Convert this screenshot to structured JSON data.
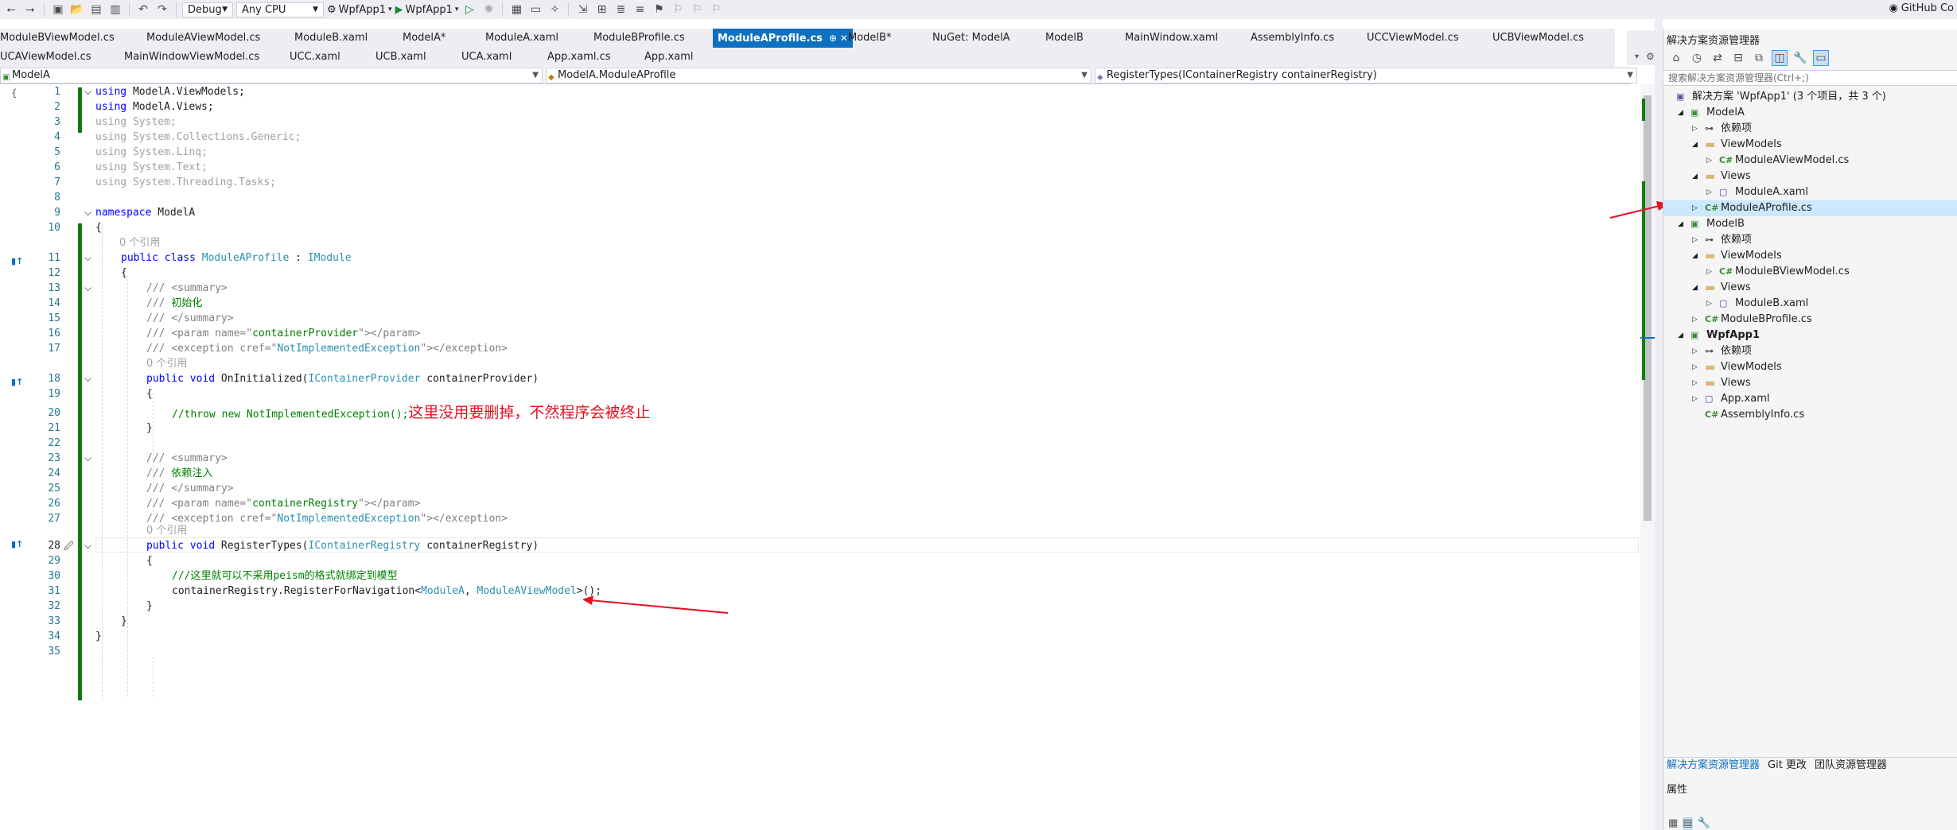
{
  "toolbar": {
    "config": "Debug",
    "platform": "Any CPU",
    "startup_project": "WpfApp1",
    "run_label": "WpfApp1",
    "github": "GitHub Co"
  },
  "tabs_row1": [
    "ModuleBViewModel.cs",
    "ModuleAViewModel.cs",
    "ModuleB.xaml",
    "ModelA*",
    "ModuleA.xaml",
    "ModuleBProfile.cs",
    "ModuleAProfile.cs",
    "ModelB*",
    "NuGet: ModelA",
    "ModelB",
    "MainWindow.xaml",
    "AssemblyInfo.cs",
    "UCCViewModel.cs",
    "UCBViewModel.cs"
  ],
  "tabs_row2": [
    "UCAViewModel.cs",
    "MainWindowViewModel.cs",
    "UCC.xaml",
    "UCB.xaml",
    "UCA.xaml",
    "App.xaml.cs",
    "App.xaml"
  ],
  "tab_active_pin": "⊕ ✕",
  "navbar": {
    "project": "ModelA",
    "class": "ModelA.ModuleAProfile",
    "member": "RegisterTypes(IContainerRegistry containerRegistry)"
  },
  "code": {
    "l1_a": "using",
    "l1_b": " ModelA.ViewModels;",
    "l2_a": "using",
    "l2_b": " ModelA.Views;",
    "l3": "using System;",
    "l4": "using System.Collections.Generic;",
    "l5": "using System.Linq;",
    "l6": "using System.Text;",
    "l7": "using System.Threading.Tasks;",
    "l9_a": "namespace",
    "l9_b": " ModelA",
    "l10": "{",
    "lens1": "0 个引用",
    "l11_a": "public class ",
    "l11_b": "ModuleAProfile",
    "l11_c": " : ",
    "l11_d": "IModule",
    "l12": "{",
    "l13_a": "/// ",
    "l13_b": "<summary>",
    "l14_a": "/// ",
    "l14_b": "初始化",
    "l15_a": "/// ",
    "l15_b": "</summary>",
    "l16_a": "/// ",
    "l16_b": "<param name=\"",
    "l16_c": "containerProvider",
    "l16_d": "\"></param>",
    "l17_a": "/// ",
    "l17_b": "<exception cref=\"",
    "l17_c": "NotImplementedException",
    "l17_d": "\"></exception>",
    "lens2": "0 个引用",
    "l18_a": "public void ",
    "l18_b": "OnInitialized(",
    "l18_c": "IContainerProvider",
    "l18_d": " containerProvider)",
    "l19": "{",
    "l20_a": "//throw new NotImplementedException();",
    "l20_note": "这里没用要删掉，不然程序会被终止",
    "l21": "}",
    "l23_a": "/// ",
    "l23_b": "<summary>",
    "l24_a": "/// ",
    "l24_b": "依赖注入",
    "l25_a": "/// ",
    "l25_b": "</summary>",
    "l26_a": "/// ",
    "l26_b": "<param name=\"",
    "l26_c": "containerRegistry",
    "l26_d": "\"></param>",
    "l27_a": "/// ",
    "l27_b": "<exception cref=\"",
    "l27_c": "NotImplementedException",
    "l27_d": "\"></exception>",
    "lens3": "0 个引用",
    "l28_a": "public void ",
    "l28_b": "RegisterTypes(",
    "l28_c": "IContainerRegistry",
    "l28_d": " containerRegistry)",
    "l29": "{",
    "l30": "///这里就可以不采用peism的格式就绑定到模型",
    "l31_a": "containerRegistry.RegisterForNavigation<",
    "l31_b": "ModuleA",
    "l31_c": ", ",
    "l31_d": "ModuleAViewModel",
    "l31_e": ">();",
    "l32": "}",
    "l33": "}",
    "l34": "}"
  },
  "line_numbers": [
    "1",
    "2",
    "3",
    "4",
    "5",
    "6",
    "7",
    "8",
    "9",
    "10",
    "11",
    "12",
    "13",
    "14",
    "15",
    "16",
    "17",
    "18",
    "19",
    "20",
    "21",
    "22",
    "23",
    "24",
    "25",
    "26",
    "27",
    "28",
    "29",
    "30",
    "31",
    "32",
    "33",
    "34",
    "35"
  ],
  "solution": {
    "title": "解决方案资源管理器",
    "search_placeholder": "搜索解决方案资源管理器(Ctrl+;)",
    "items": [
      {
        "label": "解决方案 'WpfApp1' (3 个项目，共 3 个)",
        "icon": "solution-icon",
        "indent": 0,
        "arrow": ""
      },
      {
        "label": "ModelA",
        "icon": "project-icon",
        "indent": 1,
        "arrow": "◢"
      },
      {
        "label": "依赖项",
        "icon": "dependencies-icon",
        "indent": 2,
        "arrow": "▷"
      },
      {
        "label": "ViewModels",
        "icon": "folder-icon",
        "indent": 2,
        "arrow": "◢"
      },
      {
        "label": "ModuleAViewModel.cs",
        "icon": "csharp-file-icon",
        "indent": 3,
        "arrow": "▷"
      },
      {
        "label": "Views",
        "icon": "folder-icon",
        "indent": 2,
        "arrow": "◢"
      },
      {
        "label": "ModuleA.xaml",
        "icon": "xaml-file-icon",
        "indent": 3,
        "arrow": "▷"
      },
      {
        "label": "ModuleAProfile.cs",
        "icon": "csharp-file-icon",
        "indent": 2,
        "arrow": "▷",
        "selected": true
      },
      {
        "label": "ModelB",
        "icon": "project-icon",
        "indent": 1,
        "arrow": "◢"
      },
      {
        "label": "依赖项",
        "icon": "dependencies-icon",
        "indent": 2,
        "arrow": "▷"
      },
      {
        "label": "ViewModels",
        "icon": "folder-icon",
        "indent": 2,
        "arrow": "◢"
      },
      {
        "label": "ModuleBViewModel.cs",
        "icon": "csharp-file-icon",
        "indent": 3,
        "arrow": "▷"
      },
      {
        "label": "Views",
        "icon": "folder-icon",
        "indent": 2,
        "arrow": "◢"
      },
      {
        "label": "ModuleB.xaml",
        "icon": "xaml-file-icon",
        "indent": 3,
        "arrow": "▷"
      },
      {
        "label": "ModuleBProfile.cs",
        "icon": "csharp-file-icon",
        "indent": 2,
        "arrow": "▷"
      },
      {
        "label": "WpfApp1",
        "icon": "project-icon",
        "indent": 1,
        "arrow": "◢",
        "bold": true
      },
      {
        "label": "依赖项",
        "icon": "dependencies-icon",
        "indent": 2,
        "arrow": "▷"
      },
      {
        "label": "ViewModels",
        "icon": "folder-icon",
        "indent": 2,
        "arrow": "▷"
      },
      {
        "label": "Views",
        "icon": "folder-icon",
        "indent": 2,
        "arrow": "▷"
      },
      {
        "label": "App.xaml",
        "icon": "xaml-file-icon",
        "indent": 2,
        "arrow": "▷"
      },
      {
        "label": "AssemblyInfo.cs",
        "icon": "csharp-file-icon",
        "indent": 2,
        "arrow": ""
      }
    ],
    "bottom_tabs": [
      "解决方案资源管理器",
      "Git 更改",
      "团队资源管理器"
    ],
    "props_title": "属性"
  },
  "colors": {
    "accent": "#0e70c0",
    "change_bar": "#107c10",
    "annotation": "#e81123"
  }
}
